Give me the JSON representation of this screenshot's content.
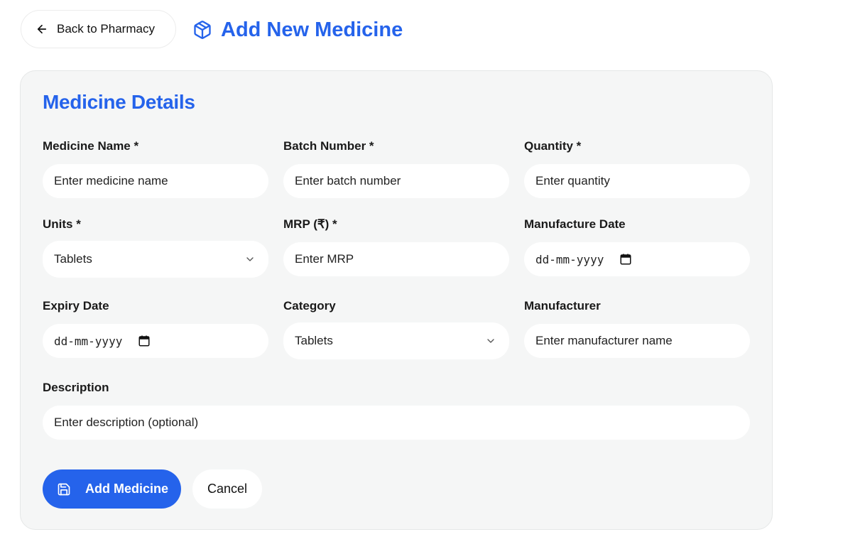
{
  "header": {
    "back_label": "Back to Pharmacy",
    "title": "Add New Medicine"
  },
  "form": {
    "section_title": "Medicine Details",
    "fields": {
      "medicine_name": {
        "label": "Medicine Name *",
        "placeholder": "Enter medicine name"
      },
      "batch_number": {
        "label": "Batch Number *",
        "placeholder": "Enter batch number"
      },
      "quantity": {
        "label": "Quantity *",
        "placeholder": "Enter quantity"
      },
      "units": {
        "label": "Units *",
        "value": "Tablets"
      },
      "mrp": {
        "label": "MRP (₹) *",
        "placeholder": "Enter MRP"
      },
      "manufacture_date": {
        "label": "Manufacture Date",
        "placeholder": "dd-mm-yyyy"
      },
      "expiry_date": {
        "label": "Expiry Date",
        "placeholder": "dd-mm-yyyy"
      },
      "category": {
        "label": "Category",
        "value": "Tablets"
      },
      "manufacturer": {
        "label": "Manufacturer",
        "placeholder": "Enter manufacturer name"
      },
      "description": {
        "label": "Description",
        "placeholder": "Enter description (optional)"
      }
    },
    "submit_label": "Add Medicine",
    "cancel_label": "Cancel"
  },
  "icons": {
    "back": "arrow-left-icon",
    "title": "package-icon",
    "dropdown": "chevron-down-icon",
    "date": "calendar-icon",
    "submit": "save-icon"
  },
  "colors": {
    "accent": "#2563eb",
    "card_background": "#f5f6f6",
    "input_background": "#ffffff"
  }
}
